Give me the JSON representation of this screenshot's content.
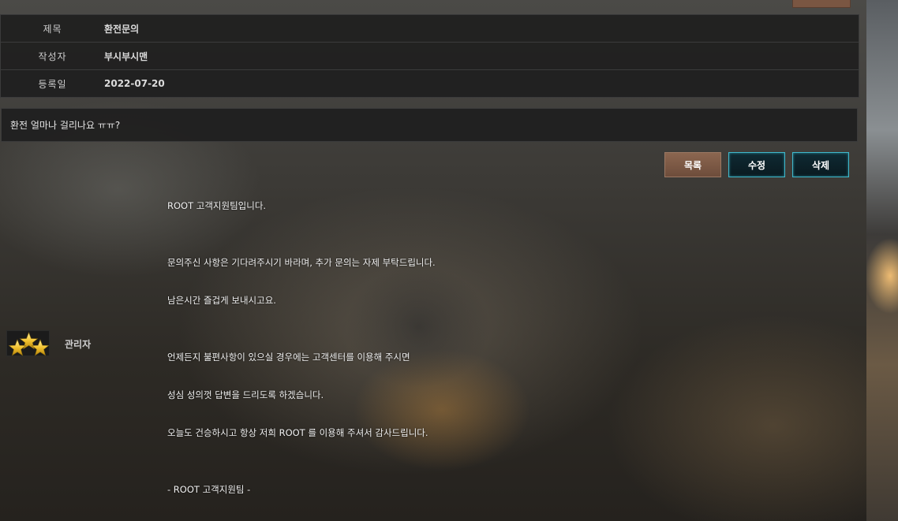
{
  "post": {
    "fields": [
      {
        "label": "제목",
        "value": "환전문의"
      },
      {
        "label": "작성자",
        "value": "부시부시맨"
      },
      {
        "label": "등록일",
        "value": "2022-07-20"
      }
    ],
    "content": "환전 얼마나 걸리나요 ㅠㅠ?"
  },
  "actions": {
    "list_label": "목록",
    "edit_label": "수정",
    "delete_label": "삭제"
  },
  "reply": {
    "author": "관리자",
    "lines": [
      "ROOT 고객지원팀입니다.",
      "문의주신 사항은 기다려주시기 바라며, 추가 문의는 자제 부탁드립니다.",
      "남은시간 즐겁게 보내시고요.",
      "언제든지 불편사항이 있으실 경우에는 고객센터를 이용해 주시면",
      "성심 성의껏 답변을 드리도록 하겠습니다.",
      "오늘도 건승하시고 항상 저희 ROOT 를 이용해 주셔서 감사드립니다.",
      "- ROOT 고객지원팀 -"
    ]
  },
  "colors": {
    "list_button": "#7a5642",
    "edit_delete_border": "#3fb8cc",
    "panel_bg": "#202020"
  },
  "icons": {
    "admin_badge": "three-gold-stars"
  }
}
